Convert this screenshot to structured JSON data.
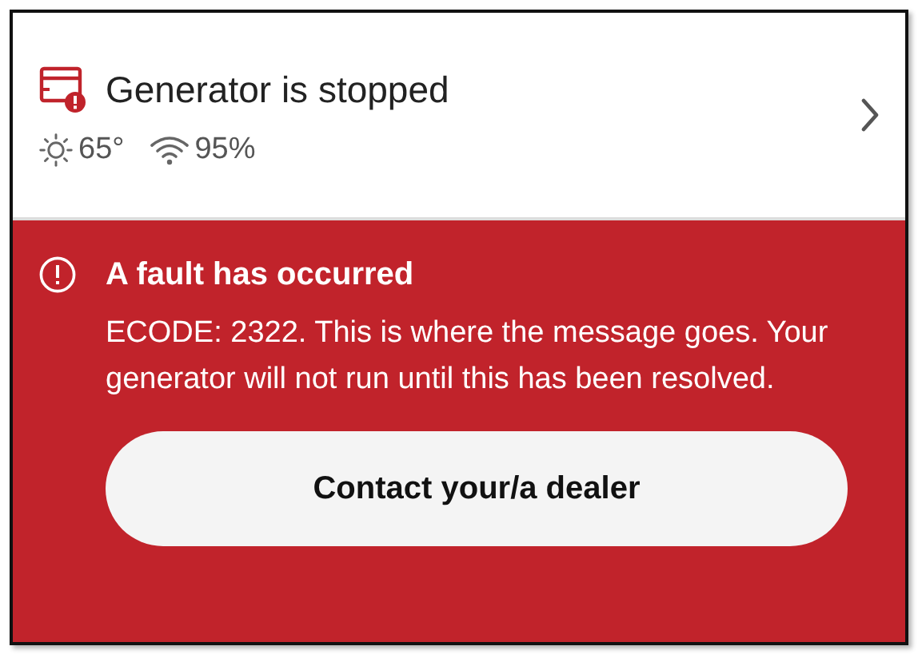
{
  "status": {
    "title": "Generator is stopped",
    "temperature": "65°",
    "signal": "95%"
  },
  "fault": {
    "title": "A fault has occurred",
    "message": "ECODE: 2322. This is where the message goes. Your generator will not run until this has been resolved."
  },
  "action": {
    "label": "Contact your/a dealer"
  }
}
